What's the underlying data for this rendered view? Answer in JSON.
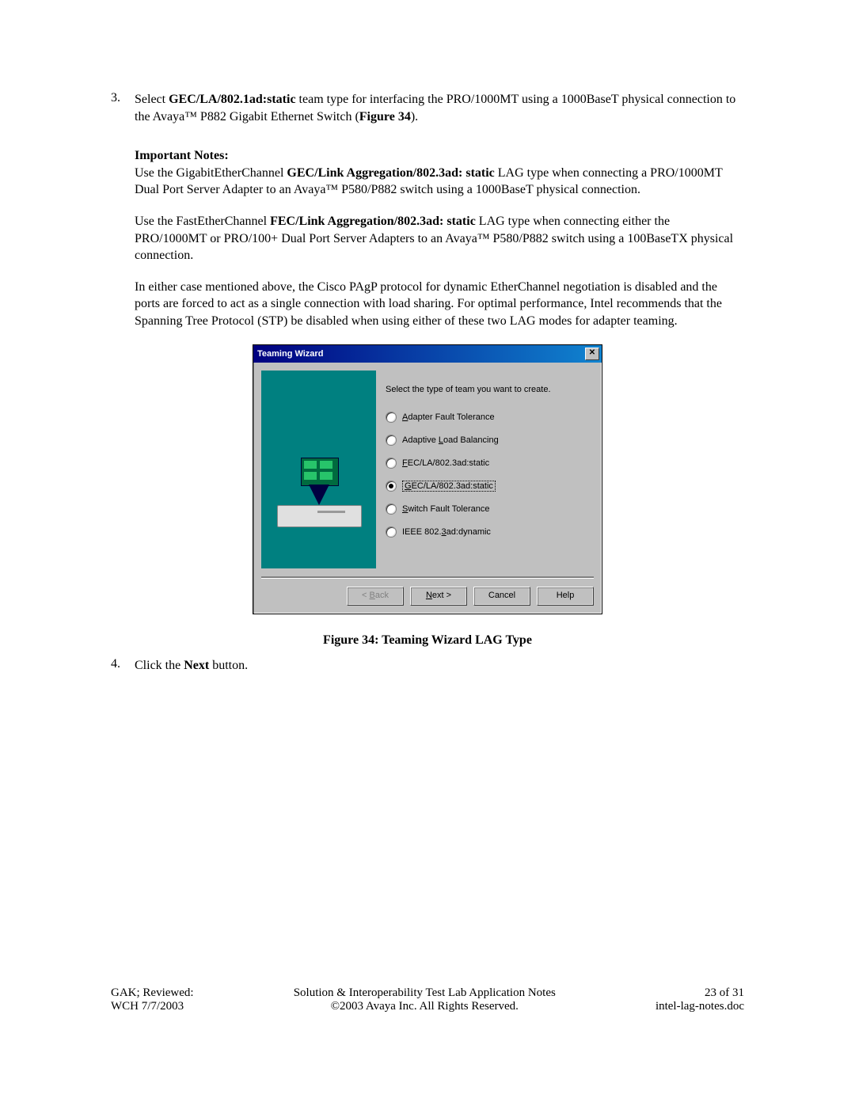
{
  "step3": {
    "num": "3.",
    "text_pre": "Select ",
    "bold1": "GEC/LA/802.1ad:static",
    "text_mid": " team type for interfacing the PRO/1000MT using a 1000BaseT physical connection to the Avaya™ P882 Gigabit Ethernet Switch (",
    "bold2": "Figure 34",
    "text_post": ")."
  },
  "notes": {
    "heading": "Important Notes:",
    "p1_pre": "Use the GigabitEtherChannel ",
    "p1_bold": "GEC/Link Aggregation/802.3ad: static",
    "p1_post": " LAG type when connecting a PRO/1000MT Dual Port Server Adapter to an Avaya™ P580/P882 switch using a 1000BaseT physical connection.",
    "p2_pre": "Use the FastEtherChannel ",
    "p2_bold": "FEC/Link Aggregation/802.3ad: static",
    "p2_post": " LAG type when connecting either the PRO/1000MT or PRO/100+ Dual Port Server Adapters to an Avaya™ P580/P882 switch using a 100BaseTX physical connection.",
    "p3": "In either case mentioned above, the Cisco PAgP protocol for dynamic EtherChannel negotiation is disabled and the ports are forced to act as a single connection with load sharing.  For optimal performance, Intel recommends that the Spanning Tree Protocol (STP) be disabled when using either of these two LAG modes for adapter teaming."
  },
  "dialog": {
    "title": "Teaming Wizard",
    "close": "✕",
    "prompt": "Select the type of team you want to create.",
    "options": [
      {
        "u": "A",
        "label": "dapter Fault Tolerance",
        "selected": false
      },
      {
        "u": "L",
        "pre": "Adaptive ",
        "label": "oad Balancing",
        "selected": false
      },
      {
        "u": "F",
        "label": "EC/LA/802.3ad:static",
        "selected": false
      },
      {
        "u": "G",
        "label": "EC/LA/802.3ad:static",
        "selected": true
      },
      {
        "u": "S",
        "label": "witch Fault Tolerance",
        "selected": false
      },
      {
        "u": "3",
        "pre": "IEEE 802.",
        "label": "ad:dynamic",
        "selected": false
      }
    ],
    "buttons": {
      "back": "< Back",
      "next_u": "N",
      "next_rest": "ext >",
      "cancel": "Cancel",
      "help": "Help"
    }
  },
  "caption": "Figure 34: Teaming Wizard LAG Type",
  "step4": {
    "num": "4.",
    "pre": "Click the ",
    "bold": "Next",
    "post": " button."
  },
  "footer": {
    "left1": "GAK; Reviewed:",
    "left2": "WCH 7/7/2003",
    "center1": "Solution & Interoperability Test Lab Application Notes",
    "center2": "©2003 Avaya Inc. All Rights Reserved.",
    "right1": "23 of 31",
    "right2": "intel-lag-notes.doc"
  }
}
